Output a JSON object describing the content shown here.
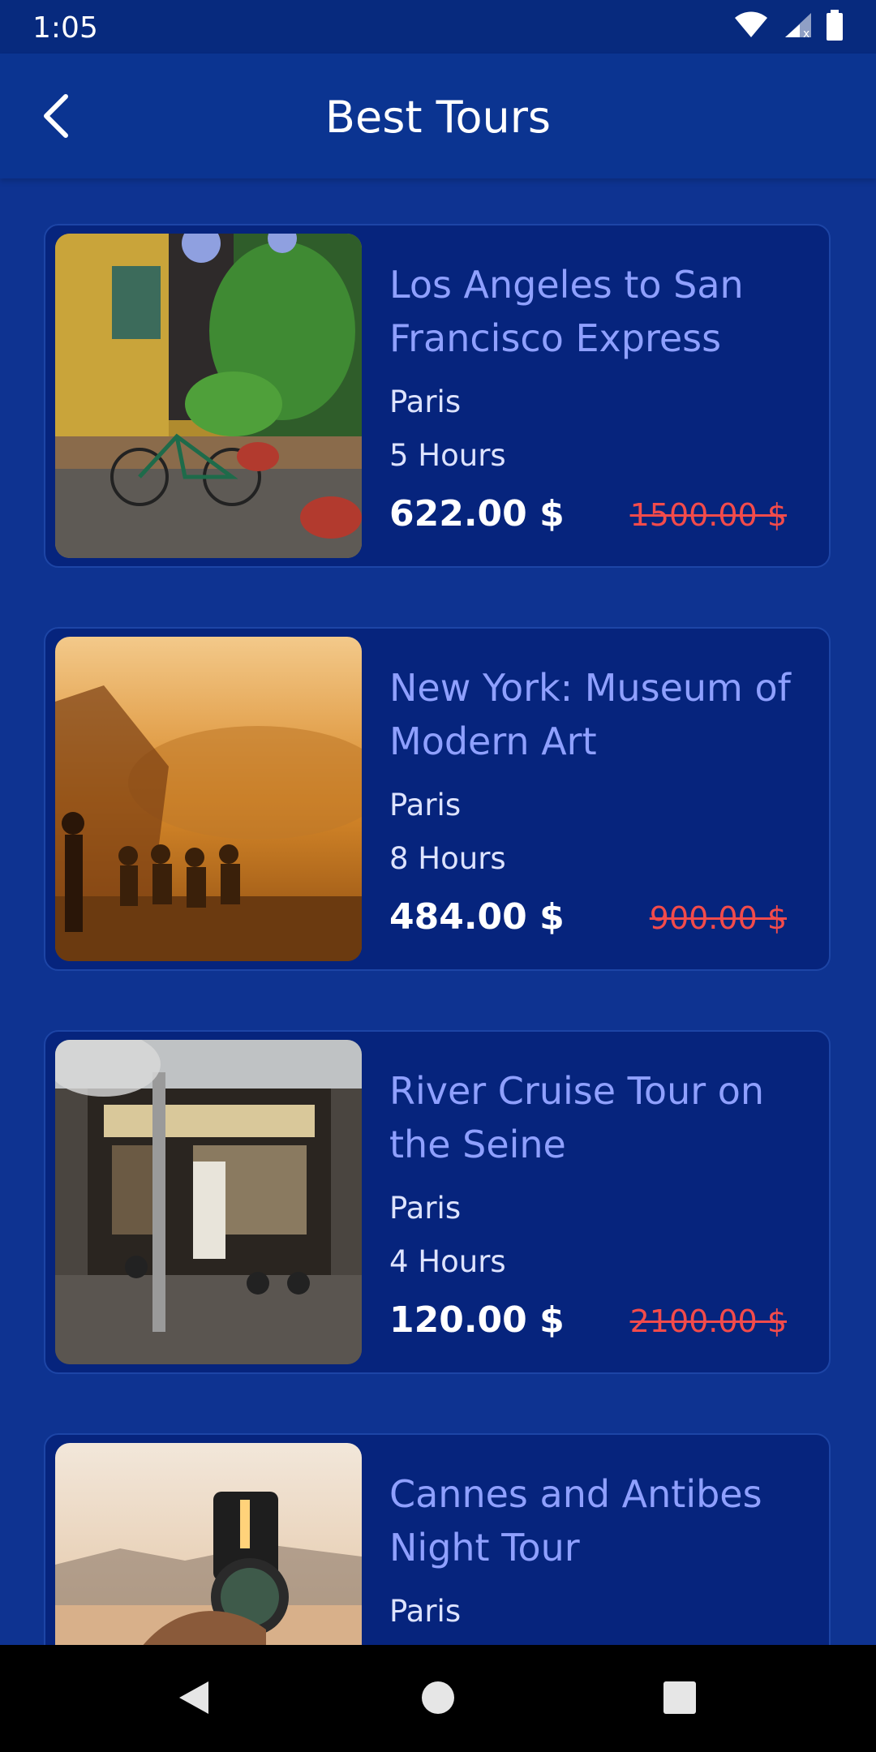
{
  "status_bar": {
    "time": "1:05",
    "icons": [
      "wifi-icon",
      "signal-icon",
      "battery-icon"
    ]
  },
  "app_bar": {
    "title": "Best Tours",
    "back_icon": "chevron-left-icon"
  },
  "tours": [
    {
      "title": "Los Angeles to San Francisco Express",
      "location": "Paris",
      "duration": "5 Hours",
      "price": "622.00 $",
      "old_price": "1500.00 $",
      "image": "street-bicycle-photo"
    },
    {
      "title": "New York: Museum of Modern Art",
      "location": "Paris",
      "duration": "8 Hours",
      "price": "484.00 $",
      "old_price": "900.00 $",
      "image": "sunset-hill-photo"
    },
    {
      "title": "River Cruise Tour on the Seine",
      "location": "Paris",
      "duration": "4 Hours",
      "price": "120.00 $",
      "old_price": "2100.00 $",
      "image": "street-food-stall-photo"
    },
    {
      "title": "Cannes and Antibes Night Tour",
      "location": "Paris",
      "duration": "",
      "price": "",
      "old_price": "",
      "image": "compass-sunset-photo"
    }
  ],
  "nav_bar": {
    "buttons": [
      "back-triangle-icon",
      "home-circle-icon",
      "recents-square-icon"
    ]
  },
  "colors": {
    "background": "#0E3391",
    "status_bar": "#072A7E",
    "card": "#06247D",
    "title_text": "#8FA0FF",
    "old_price": "#F24B4B"
  }
}
